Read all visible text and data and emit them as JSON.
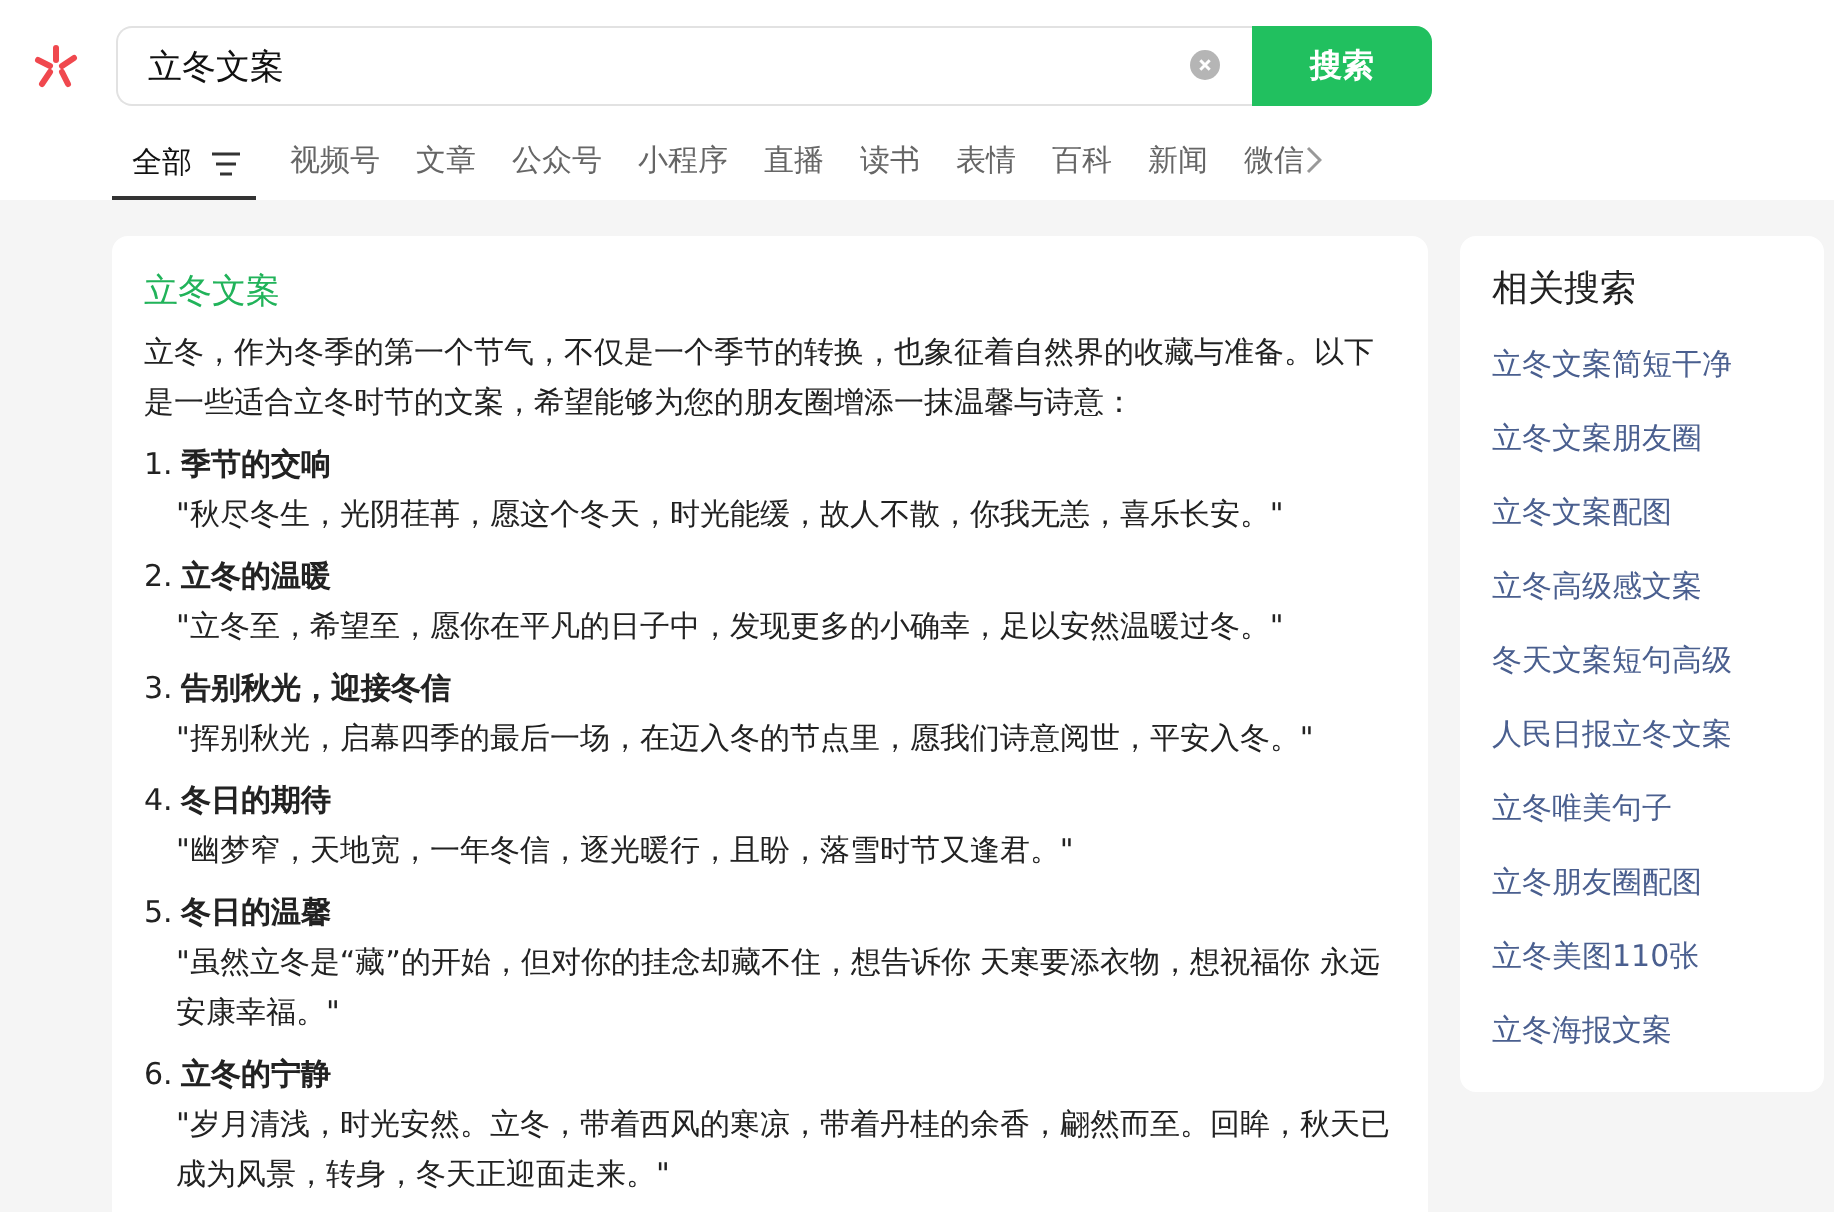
{
  "search": {
    "value": "立冬文案",
    "button": "搜索"
  },
  "tabs": [
    {
      "label": "全部",
      "selected": true
    },
    {
      "label": "视频号",
      "selected": false
    },
    {
      "label": "文章",
      "selected": false
    },
    {
      "label": "公众号",
      "selected": false
    },
    {
      "label": "小程序",
      "selected": false
    },
    {
      "label": "直播",
      "selected": false
    },
    {
      "label": "读书",
      "selected": false
    },
    {
      "label": "表情",
      "selected": false
    },
    {
      "label": "百科",
      "selected": false
    },
    {
      "label": "新闻",
      "selected": false
    },
    {
      "label": "微信",
      "selected": false
    }
  ],
  "result": {
    "title": "立冬文案",
    "intro": "立冬，作为冬季的第一个节气，不仅是一个季节的转换，也象征着自然界的收藏与准备。以下是一些适合立冬时节的文案，希望能够为您的朋友圈增添一抹温馨与诗意：",
    "items": [
      {
        "number": "1.",
        "heading": "季节的交响",
        "quote": "\"秋尽冬生，光阴荏苒，愿这个冬天，时光能缓，故人不散，你我无恙，喜乐长安。\""
      },
      {
        "number": "2.",
        "heading": "立冬的温暖",
        "quote": "\"立冬至，希望至，愿你在平凡的日子中，发现更多的小确幸，足以安然温暖过冬。\""
      },
      {
        "number": "3.",
        "heading": "告别秋光，迎接冬信",
        "quote": "\"挥别秋光，启幕四季的最后一场，在迈入冬的节点里，愿我们诗意阅世，平安入冬。\""
      },
      {
        "number": "4.",
        "heading": "冬日的期待",
        "quote": "\"幽梦窄，天地宽，一年冬信，逐光暖行，且盼，落雪时节又逢君。\""
      },
      {
        "number": "5.",
        "heading": "冬日的温馨",
        "quote": "\"虽然立冬是“藏”的开始，但对你的挂念却藏不住，想告诉你 天寒要添衣物，想祝福你 永远安康幸福。\""
      },
      {
        "number": "6.",
        "heading": "立冬的宁静",
        "quote": "\"岁月清浅，时光安然。立冬，带着西风的寒凉，带着丹桂的余香，翩然而至。回眸，秋天已成为风景，转身，冬天正迎面走来。\""
      }
    ]
  },
  "related": {
    "title": "相关搜索",
    "items": [
      "立冬文案简短干净",
      "立冬文案朋友圈",
      "立冬文案配图",
      "立冬高级感文案",
      "冬天文案短句高级",
      "人民日报立冬文案",
      "立冬唯美句子",
      "立冬朋友圈配图",
      "立冬美图110张",
      "立冬海报文案"
    ]
  }
}
